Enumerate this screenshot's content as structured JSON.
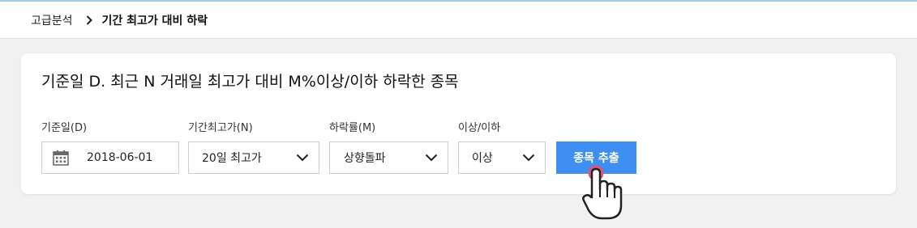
{
  "breadcrumb": {
    "root": "고급분석",
    "current": "기간 최고가 대비 하락"
  },
  "card": {
    "title": "기준일 D. 최근 N 거래일 최고가 대비 M%이상/이하 하락한 종목"
  },
  "form": {
    "date": {
      "label": "기준일(D)",
      "value": "2018-06-01",
      "icon": "calendar-icon"
    },
    "period": {
      "label": "기간최고가(N)",
      "value": "20일 최고가"
    },
    "drop_rate": {
      "label": "하락률(M)",
      "value": "상향돌파"
    },
    "direction": {
      "label": "이상/이하",
      "value": "이상"
    },
    "submit_label": "종목 추출"
  },
  "colors": {
    "accent": "#3f8ff3",
    "cursor_ring": "#e0527a"
  }
}
